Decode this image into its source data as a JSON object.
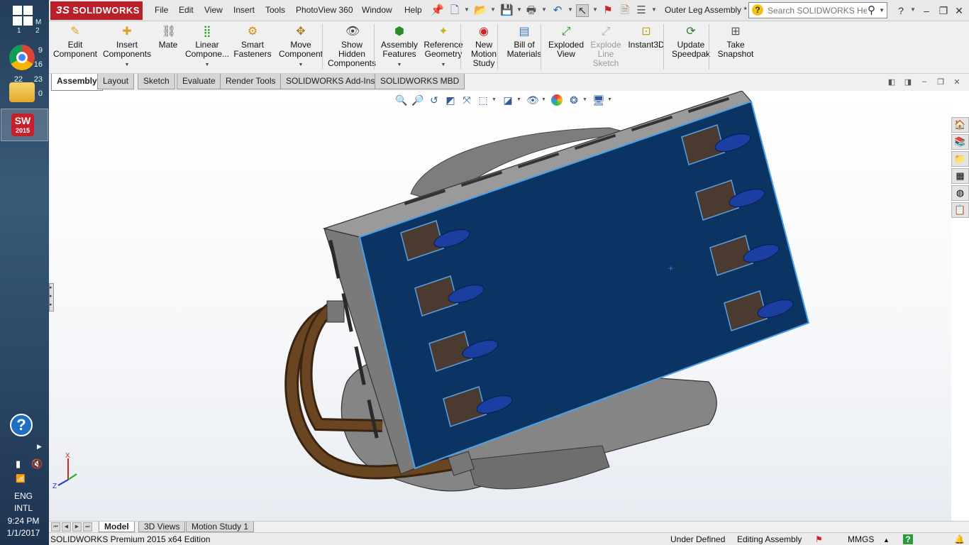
{
  "taskbar": {
    "start_numbers": [
      "S",
      "M"
    ],
    "calendar_numbers": [
      "1",
      "2"
    ],
    "chrome_badges": [
      "9",
      "16"
    ],
    "explorer_badges": [
      "22",
      "23",
      "0"
    ],
    "solidworks_version": "2015",
    "language": "ENG",
    "layout": "INTL",
    "time": "9:24 PM",
    "date": "1/1/2017"
  },
  "app": {
    "name": "SOLIDWORKS",
    "brand_prefix": "3S",
    "menu": [
      "File",
      "Edit",
      "View",
      "Insert",
      "Tools",
      "PhotoView 360",
      "Window",
      "Help"
    ],
    "document_title": "Outer Leg Assembly *",
    "search_placeholder": "Search SOLIDWORKS Help"
  },
  "commands": [
    {
      "label": "Edit\nComponent",
      "icon": "edit-component-icon",
      "dropdown": false,
      "enabled": true
    },
    {
      "label": "Insert\nComponents",
      "icon": "insert-components-icon",
      "dropdown": true,
      "enabled": true
    },
    {
      "label": "Mate",
      "icon": "mate-icon",
      "dropdown": false,
      "enabled": true
    },
    {
      "label": "Linear\nCompone...",
      "icon": "linear-pattern-icon",
      "dropdown": true,
      "enabled": true
    },
    {
      "label": "Smart\nFasteners",
      "icon": "smart-fasteners-icon",
      "dropdown": false,
      "enabled": true
    },
    {
      "label": "Move\nComponent",
      "icon": "move-component-icon",
      "dropdown": true,
      "enabled": true
    },
    {
      "label": "Show\nHidden\nComponents",
      "icon": "show-hidden-icon",
      "dropdown": false,
      "enabled": true
    },
    {
      "label": "Assembly\nFeatures",
      "icon": "assembly-features-icon",
      "dropdown": true,
      "enabled": true
    },
    {
      "label": "Reference\nGeometry",
      "icon": "reference-geometry-icon",
      "dropdown": true,
      "enabled": true
    },
    {
      "label": "New\nMotion\nStudy",
      "icon": "motion-study-icon",
      "dropdown": false,
      "enabled": true
    },
    {
      "label": "Bill of\nMaterials",
      "icon": "bill-of-materials-icon",
      "dropdown": false,
      "enabled": true
    },
    {
      "label": "Exploded\nView",
      "icon": "exploded-view-icon",
      "dropdown": false,
      "enabled": true
    },
    {
      "label": "Explode\nLine\nSketch",
      "icon": "explode-line-icon",
      "dropdown": false,
      "enabled": false
    },
    {
      "label": "Instant3D",
      "icon": "instant3d-icon",
      "dropdown": false,
      "enabled": true
    },
    {
      "label": "Update\nSpeedpak",
      "icon": "speedpak-icon",
      "dropdown": false,
      "enabled": true
    },
    {
      "label": "Take\nSnapshot",
      "icon": "snapshot-icon",
      "dropdown": false,
      "enabled": true
    }
  ],
  "tabs": [
    "Assembly",
    "Layout",
    "Sketch",
    "Evaluate",
    "Render Tools",
    "SOLIDWORKS Add-Ins",
    "SOLIDWORKS MBD"
  ],
  "active_tab": "Assembly",
  "bottom_tabs": [
    "Model",
    "3D Views",
    "Motion Study 1"
  ],
  "active_bottom_tab": "Model",
  "triad_labels": {
    "x": "X",
    "z": "Z"
  },
  "status": {
    "edition": "SOLIDWORKS Premium 2015 x64 Edition",
    "definition": "Under Defined",
    "mode": "Editing Assembly",
    "units": "MMGS"
  },
  "colors": {
    "accent": "#b8202a",
    "panel": "#0c3463",
    "panel_edge": "#4aa0e8",
    "housing": "#8a8a8a",
    "cable": "#5a3a1c"
  }
}
